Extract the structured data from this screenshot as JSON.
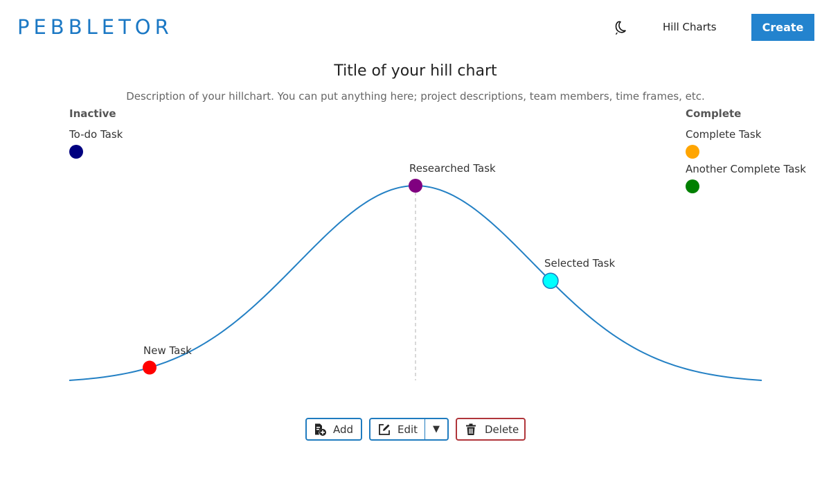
{
  "header": {
    "brand": "PEBBLETOR",
    "theme_icon": "moon-icon",
    "nav_link": "Hill Charts",
    "create_label": "Create"
  },
  "chart": {
    "title": "Title of your hill chart",
    "description": "Description of your hillchart. You can put anything here; project descriptions, team members, time frames, etc.",
    "inactive": {
      "heading": "Inactive",
      "tasks": [
        {
          "label": "To-do Task",
          "color": "#000080"
        }
      ]
    },
    "complete": {
      "heading": "Complete",
      "tasks": [
        {
          "label": "Complete Task",
          "color": "#FFA500"
        },
        {
          "label": "Another Complete Task",
          "color": "#008000"
        }
      ]
    },
    "hill_tasks": [
      {
        "label": "New Task",
        "color": "#FF0000",
        "progress": 0.116,
        "selected": false
      },
      {
        "label": "Researched Task",
        "color": "#800080",
        "progress": 0.5,
        "selected": false
      },
      {
        "label": "Selected Task",
        "color": "#00FFFF",
        "progress": 0.695,
        "selected": true
      }
    ],
    "curve_color": "#2380c4"
  },
  "toolbar": {
    "add_label": "Add",
    "edit_label": "Edit",
    "edit_dropdown": "▼",
    "delete_label": "Delete"
  }
}
